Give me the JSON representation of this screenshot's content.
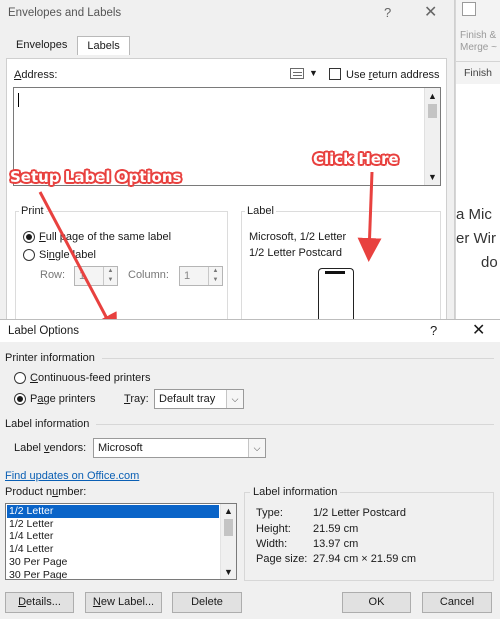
{
  "word_window": {
    "ribbon_finish_merge": "Finish & Merge ~",
    "ribbon_group": "Finish",
    "doc_lines": [
      "a Mic",
      "er Wir",
      "do"
    ]
  },
  "envelopes_dialog": {
    "title": "Envelopes and Labels",
    "help": "?",
    "close": "✕",
    "tabs": [
      "Envelopes",
      "Labels"
    ],
    "active_tab": "Labels",
    "address_label": "Address:",
    "address_value": "",
    "use_return_address": "Use return address",
    "use_return_address_checked": false,
    "print": {
      "legend": "Print",
      "full_page": "Full page of the same label",
      "single_label": "Single label",
      "selected": "full_page",
      "row_label": "Row:",
      "row_value": "1",
      "column_label": "Column:",
      "column_value": "1"
    },
    "label": {
      "legend": "Label",
      "vendor_line": "Microsoft, 1/2 Letter",
      "product_line": "1/2 Letter Postcard"
    }
  },
  "annotations": {
    "setup": "Setup Label Options",
    "click": "Click Here",
    "color": "#e8413f"
  },
  "label_options": {
    "title": "Label Options",
    "help": "?",
    "close": "✕",
    "printer_information": "Printer information",
    "continuous_feed": "Continuous-feed printers",
    "page_printers": "Page printers",
    "printer_selected": "page_printers",
    "tray_label": "Tray:",
    "tray_value": "Default tray",
    "label_information": "Label information",
    "vendor_label": "Label vendors:",
    "vendor_value": "Microsoft",
    "updates_link": "Find updates on Office.com",
    "product_number_label": "Product number:",
    "products": [
      "1/2 Letter",
      "1/2 Letter",
      "1/4 Letter",
      "1/4 Letter",
      "30 Per Page",
      "30 Per Page"
    ],
    "selected_product_index": 0,
    "info": {
      "legend": "Label information",
      "type_label": "Type:",
      "type_value": "1/2 Letter Postcard",
      "height_label": "Height:",
      "height_value": "21.59 cm",
      "width_label": "Width:",
      "width_value": "13.97 cm",
      "page_size_label": "Page size:",
      "page_size_value": "27.94 cm × 21.59 cm"
    },
    "buttons": {
      "details": "Details...",
      "new_label": "New Label...",
      "delete": "Delete",
      "ok": "OK",
      "cancel": "Cancel"
    },
    "accent": "#0a64c8"
  }
}
